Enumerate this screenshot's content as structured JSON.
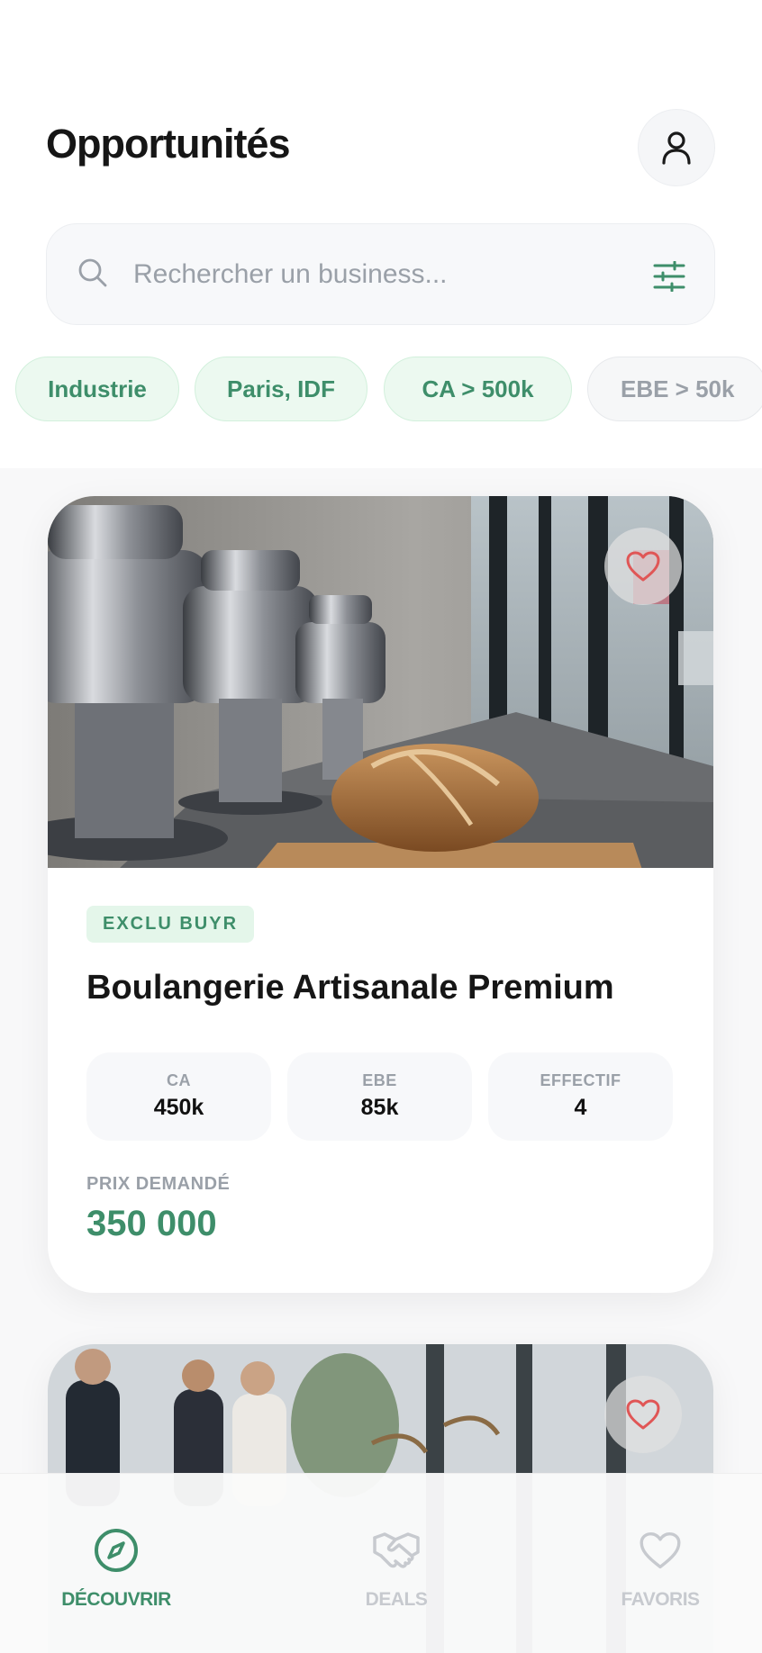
{
  "header": {
    "title": "Opportunités"
  },
  "search": {
    "placeholder": "Rechercher un business..."
  },
  "filters": [
    {
      "label": "Industrie",
      "active": true
    },
    {
      "label": "Paris, IDF",
      "active": true
    },
    {
      "label": "CA > 500k",
      "active": true
    },
    {
      "label": "EBE > 50k",
      "active": false
    }
  ],
  "listings": [
    {
      "badge": "EXCLU BUYR",
      "name": "Boulangerie Artisanale Premium",
      "stats": [
        {
          "label": "CA",
          "value": "450k"
        },
        {
          "label": "EBE",
          "value": "85k"
        },
        {
          "label": "EFFECTIF",
          "value": "4"
        }
      ],
      "price_label": "PRIX DEMANDÉ",
      "price": "350 000",
      "image": "bakery-bread-photo"
    },
    {
      "image": "office-meeting-photo"
    }
  ],
  "bottom_nav": [
    {
      "label": "DÉCOUVRIR",
      "icon": "compass-icon",
      "active": true
    },
    {
      "label": "DEALS",
      "icon": "handshake-icon",
      "active": false
    },
    {
      "label": "FAVORIS",
      "icon": "heart-icon",
      "active": false
    }
  ],
  "colors": {
    "accent": "#3e8e6a",
    "chip_bg": "#ecf9f0",
    "heart": "#e05656"
  }
}
